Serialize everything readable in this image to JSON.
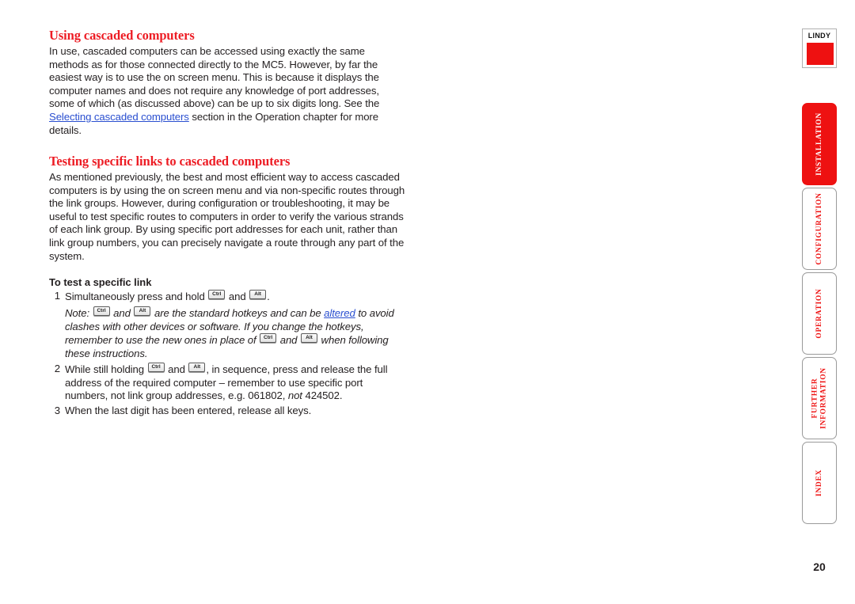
{
  "document": {
    "page_number": "20",
    "accent_color": "#ed1c24",
    "link_color": "#2a4fd0"
  },
  "logo": {
    "wordmark": "LINDY"
  },
  "tabs": [
    {
      "label": "INSTALLATION",
      "active": true
    },
    {
      "label": "CONFIGURATION",
      "active": false
    },
    {
      "label": "OPERATION",
      "active": false
    },
    {
      "label": "FURTHER\nINFORMATION",
      "active": false
    },
    {
      "label": "INDEX",
      "active": false
    }
  ],
  "content": {
    "heading_1": "Using cascaded computers",
    "paragraph_1_part_1": "In use, cascaded computers can be accessed using exactly the same methods as for those connected directly to the MC5. However, by far the easiest way is to use the on screen menu. This is because it displays the computer names and does not require any knowledge of port addresses, some of which (as discussed above) can be up to six digits long. See the ",
    "paragraph_1_link": "Selecting cascaded computers",
    "paragraph_1_part_2": " section in the Operation chapter for more details.",
    "heading_2": "Testing specific links to cascaded computers",
    "paragraph_2": "As mentioned previously, the best and most efficient way to access cascaded computers is by using the on screen menu and via non-specific routes through the link groups. However, during configuration or troubleshooting, it may be useful to test specific routes to computers in order to verify the various strands of each link group. By using specific port addresses for each unit, rather than link group numbers, you can precisely navigate a route through any part of the system.",
    "sub_heading": "To test a specific link",
    "keys": {
      "ctrl": "Ctrl",
      "alt": "Alt"
    },
    "step_1": {
      "number": "1",
      "text_before_ctrl": "Simultaneously press and hold ",
      "text_between_keys": " and ",
      "text_after_alt": "."
    },
    "note": {
      "lead": "Note: ",
      "between_keys": " and ",
      "after_keys": " are the standard hotkeys and can be ",
      "link": "altered",
      "after_link": " to avoid clashes with other devices or software. If you change the hotkeys, remember to use the new ones in place of ",
      "between_keys_2": " and ",
      "tail": " when following these instructions."
    },
    "step_2": {
      "number": "2",
      "text_before_ctrl": "While still holding ",
      "text_between_keys": " and ",
      "text_after_alt": ", in sequence, press and release the full address of the required computer – remember to use specific port numbers, not link group addresses, e.g. 061802, ",
      "italic_word": "not",
      "text_end": " 424502."
    },
    "step_3": {
      "number": "3",
      "text": "When the last digit has been entered, release all keys."
    }
  }
}
